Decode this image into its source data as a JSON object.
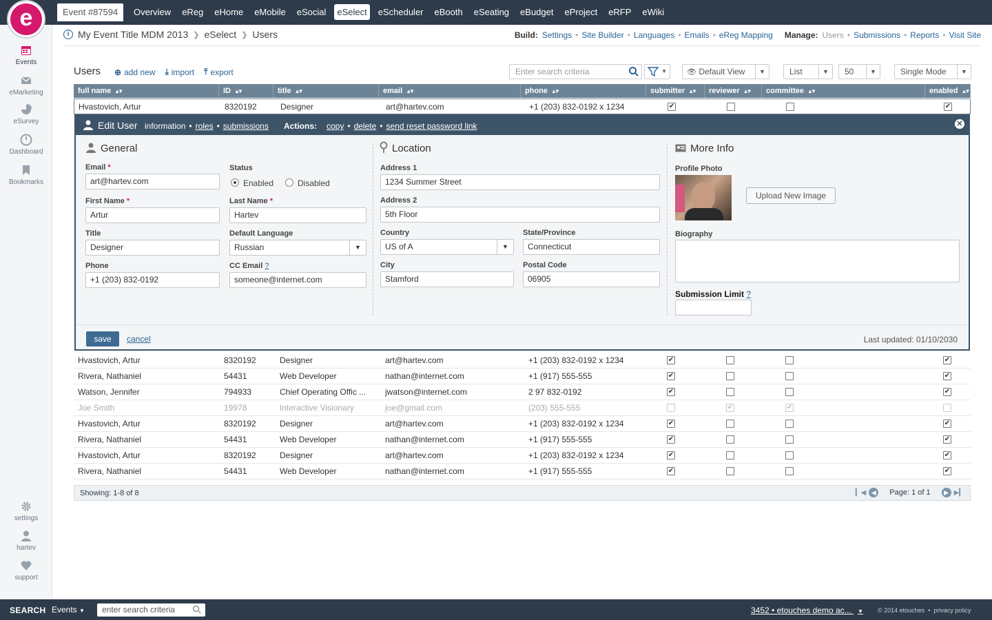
{
  "top": {
    "event_tab": "Event #87594",
    "nav": [
      "Overview",
      "eReg",
      "eHome",
      "eMobile",
      "eSocial",
      "eSelect",
      "eScheduler",
      "eBooth",
      "eSeating",
      "eBudget",
      "eProject",
      "eRFP",
      "eWiki"
    ],
    "active_nav": "eSelect",
    "logo_letter": "e"
  },
  "sidebar": {
    "top_items": [
      {
        "label": "Events",
        "icon": "calendar-icon"
      },
      {
        "label": "eMarketing",
        "icon": "envelope-icon"
      },
      {
        "label": "eSurvey",
        "icon": "pie-chart-icon"
      },
      {
        "label": "Dashboard",
        "icon": "gauge-icon"
      },
      {
        "label": "Bookmarks",
        "icon": "bookmark-icon"
      }
    ],
    "bottom_items": [
      {
        "label": "settings",
        "icon": "gear-icon"
      },
      {
        "label": "hartev",
        "icon": "user-icon"
      },
      {
        "label": "support",
        "icon": "heart-icon"
      }
    ]
  },
  "breadcrumb": [
    "My Event Title MDM 2013",
    "eSelect",
    "Users"
  ],
  "build": {
    "label": "Build:",
    "links": [
      "Settings",
      "Site Builder",
      "Languages",
      "Emails",
      "eReg Mapping"
    ],
    "manage_label": "Manage:",
    "manage_current": "Users",
    "manage_links": [
      "Submissions",
      "Reports",
      "Visit Site"
    ]
  },
  "users_bar": {
    "title": "Users",
    "add_new": "add new",
    "import": "import",
    "export": "export",
    "search_placeholder": "Enter search criteria",
    "view": "Default View",
    "list": "List",
    "per_page": "50",
    "mode": "Single Mode"
  },
  "columns": [
    "full name",
    "ID",
    "title",
    "email",
    "phone",
    "submitter",
    "reviewer",
    "committee",
    "enabled"
  ],
  "selected_row": {
    "name": "Hvastovich, Artur",
    "id": "8320192",
    "title": "Designer",
    "email": "art@hartev.com",
    "phone": "+1 (203) 832-0192 x 1234",
    "submitter": true,
    "reviewer": false,
    "committee": false,
    "enabled": true
  },
  "rows": [
    {
      "name": "Hvastovich, Artur",
      "id": "8320192",
      "title": "Designer",
      "email": "art@hartev.com",
      "phone": "+1 (203) 832-0192 x 1234",
      "submitter": true,
      "reviewer": false,
      "committee": false,
      "enabled": true,
      "dim": false
    },
    {
      "name": "Rivera, Nathaniel",
      "id": "54431",
      "title": "Web Developer",
      "email": "nathan@internet.com",
      "phone": "+1 (917) 555-555",
      "submitter": true,
      "reviewer": false,
      "committee": false,
      "enabled": true,
      "dim": false
    },
    {
      "name": "Watson, Jennifer",
      "id": "794933",
      "title": "Chief Operating Offic ...",
      "email": "jwatson@internet.com",
      "phone": "2 97 832-0192",
      "submitter": true,
      "reviewer": false,
      "committee": false,
      "enabled": true,
      "dim": false
    },
    {
      "name": "Joe Smith",
      "id": "19978",
      "title": "Interactive Visionary",
      "email": "joe@gmail.com",
      "phone": "(203) 555-555",
      "submitter": false,
      "reviewer": true,
      "committee": true,
      "enabled": false,
      "dim": true
    },
    {
      "name": "Hvastovich, Artur",
      "id": "8320192",
      "title": "Designer",
      "email": "art@hartev.com",
      "phone": "+1 (203) 832-0192 x 1234",
      "submitter": true,
      "reviewer": false,
      "committee": false,
      "enabled": true,
      "dim": false
    },
    {
      "name": "Rivera, Nathaniel",
      "id": "54431",
      "title": "Web Developer",
      "email": "nathan@internet.com",
      "phone": "+1 (917) 555-555",
      "submitter": true,
      "reviewer": false,
      "committee": false,
      "enabled": true,
      "dim": false
    },
    {
      "name": "Hvastovich, Artur",
      "id": "8320192",
      "title": "Designer",
      "email": "art@hartev.com",
      "phone": "+1 (203) 832-0192 x 1234",
      "submitter": true,
      "reviewer": false,
      "committee": false,
      "enabled": true,
      "dim": false
    },
    {
      "name": "Rivera, Nathaniel",
      "id": "54431",
      "title": "Web Developer",
      "email": "nathan@internet.com",
      "phone": "+1 (917) 555-555",
      "submitter": true,
      "reviewer": false,
      "committee": false,
      "enabled": true,
      "dim": false
    }
  ],
  "edit": {
    "title": "Edit User",
    "links": [
      "information",
      "roles",
      "submissions"
    ],
    "actions_label": "Actions:",
    "actions": [
      "copy",
      "delete",
      "send reset password link"
    ],
    "general": {
      "title": "General",
      "email_label": "Email",
      "email": "art@hartev.com",
      "status_label": "Status",
      "status_enabled": "Enabled",
      "status_disabled": "Disabled",
      "first_label": "First Name",
      "first": "Artur",
      "last_label": "Last Name",
      "last": "Hartev",
      "title_label": "Title",
      "title_val": "Designer",
      "lang_label": "Default Language",
      "lang": "Russian",
      "phone_label": "Phone",
      "phone": "+1 (203) 832-0192",
      "cc_label": "CC Email",
      "cc_help": "?",
      "cc": "someone@internet.com"
    },
    "location": {
      "title": "Location",
      "addr1_label": "Address 1",
      "addr1": "1234 Summer Street",
      "addr2_label": "Address 2",
      "addr2": "5th Floor",
      "country_label": "Country",
      "country": "US of A",
      "state_label": "State/Province",
      "state": "Connecticut",
      "city_label": "City",
      "city": "Stamford",
      "postal_label": "Postal Code",
      "postal": "06905"
    },
    "more": {
      "title": "More Info",
      "photo_label": "Profile Photo",
      "upload": "Upload New Image",
      "bio_label": "Biography",
      "limit_label": "Submission Limit",
      "limit_help": "?"
    },
    "save": "save",
    "cancel": "cancel",
    "last_updated": "Last updated: 01/10/2030"
  },
  "table_footer": {
    "showing": "Showing: 1-8 of 8",
    "page": "Page: 1 of 1"
  },
  "bottom": {
    "search_label": "SEARCH",
    "scope": "Events",
    "placeholder": "enter search criteria",
    "account": "3452 • etouches demo ac...",
    "copyright": "© 2014 etouches",
    "privacy": "privacy policy"
  }
}
